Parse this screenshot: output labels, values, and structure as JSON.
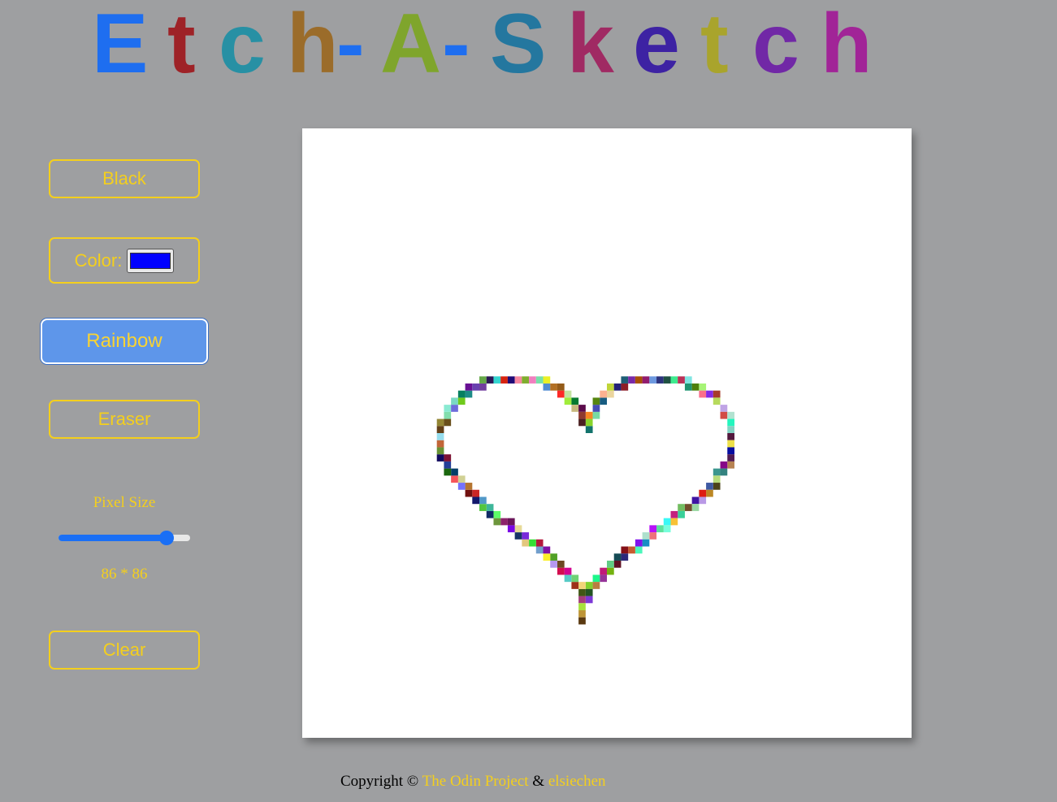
{
  "title": {
    "letters": [
      {
        "char": "E",
        "color": "#1e6ef0"
      },
      {
        "char": "t",
        "color": "#9e2227"
      },
      {
        "char": "c",
        "color": "#2790a4"
      },
      {
        "char": "h",
        "color": "#9b6c2a"
      },
      {
        "char": "-",
        "color": "#1e6ef0"
      },
      {
        "char": "A",
        "color": "#7fa52c"
      },
      {
        "char": "-",
        "color": "#1e6ef0"
      },
      {
        "char": "S",
        "color": "#24779f"
      },
      {
        "char": "k",
        "color": "#a02a63"
      },
      {
        "char": "e",
        "color": "#3d22a3"
      },
      {
        "char": "t",
        "color": "#a9a42c"
      },
      {
        "char": "c",
        "color": "#7128a6"
      },
      {
        "char": "h",
        "color": "#a12497"
      }
    ]
  },
  "controls": {
    "black_label": "Black",
    "color_label": "Color:",
    "color_value": "#0000ff",
    "rainbow_label": "Rainbow",
    "eraser_label": "Eraser",
    "pixel_size_label": "Pixel Size",
    "pixel_size_value": 86,
    "pixel_size_min": 1,
    "pixel_size_max": 100,
    "pixel_size_readout": "86 * 86",
    "clear_label": "Clear",
    "active_mode": "Rainbow"
  },
  "footer": {
    "prefix": "Copyright ©",
    "link1": "The Odin Project",
    "separator": "&",
    "link2": "elsiechen"
  },
  "theme": {
    "background": "#9e9fa1",
    "accent": "#f4cf1d",
    "active_button": "#5e96ea",
    "slider": "#1a6ff5"
  }
}
